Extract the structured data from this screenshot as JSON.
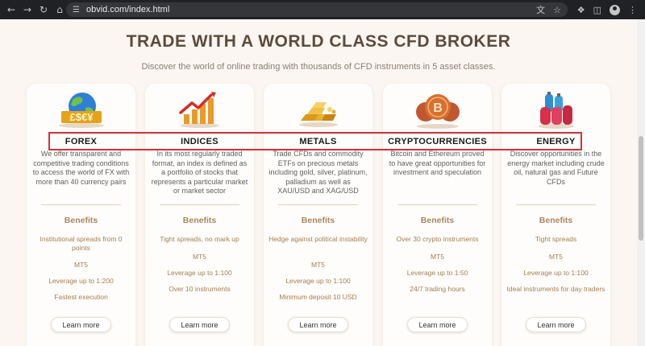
{
  "browser": {
    "url": "obvid.com/index.html",
    "icons": [
      "back-arrow-icon",
      "forward-arrow-icon",
      "reload-icon",
      "home-icon",
      "site-settings-icon",
      "translate-icon",
      "bookmark-star-icon",
      "extensions-icon",
      "sidebar-icon",
      "profile-icon",
      "menu-icon"
    ]
  },
  "page": {
    "title": "TRADE WITH A WORLD CLASS CFD BROKER",
    "subtitle": "Discover the world of online trading with thousands of CFD instruments in 5 asset classes."
  },
  "cards": [
    {
      "name": "FOREX",
      "description": "We offer transparent and competitive trading conditions to access the world of FX with more than 40 currency pairs",
      "benefits_heading": "Benefits",
      "benefits": [
        "Institutional spreads from 0 points",
        "MT5",
        "Leverage up to 1:200",
        "Fastest execution"
      ],
      "button": "Learn more"
    },
    {
      "name": "INDICES",
      "description": "In its most regularly traded format, an index is defined as a portfolio of stocks that represents a particular market or market sector",
      "benefits_heading": "Benefits",
      "benefits": [
        "Tight spreads, no mark up",
        "MT5",
        "Leverage up to 1:100",
        "Over 10 instruments"
      ],
      "button": "Learn more"
    },
    {
      "name": "METALS",
      "description": "Trade CFDs and commodity ETFs on precious metals including gold, silver, platinum, palladium as well as XAU/USD and XAG/USD",
      "benefits_heading": "Benefits",
      "benefits": [
        "Hedge against political instability",
        "MT5",
        "Leverage up to 1:100",
        "Minimum deposit 10 USD"
      ],
      "button": "Learn more"
    },
    {
      "name": "CRYPTOCURRENCIES",
      "description": "Bitcoin and Ethereum proved to have great opportunities for investment and speculation",
      "benefits_heading": "Benefits",
      "benefits": [
        "Over 30 crypto instruments",
        "MT5",
        "Leverage up to 1:50",
        "24/7 trading hours"
      ],
      "button": "Learn more"
    },
    {
      "name": "ENERGY",
      "description": "Discover opportunities in the energy market including crude oil, natural gas and Future CFDs",
      "benefits_heading": "Benefits",
      "benefits": [
        "Tight spreads",
        "MT5",
        "Leverage up to 1:100",
        "Ideal instruments for day traders"
      ],
      "button": "Learn more"
    }
  ],
  "colors": {
    "page_bg": "#fbf6f1",
    "heading": "#5c4a3c",
    "accent_gold": "#a8875d",
    "highlight_box": "#d3313c"
  }
}
